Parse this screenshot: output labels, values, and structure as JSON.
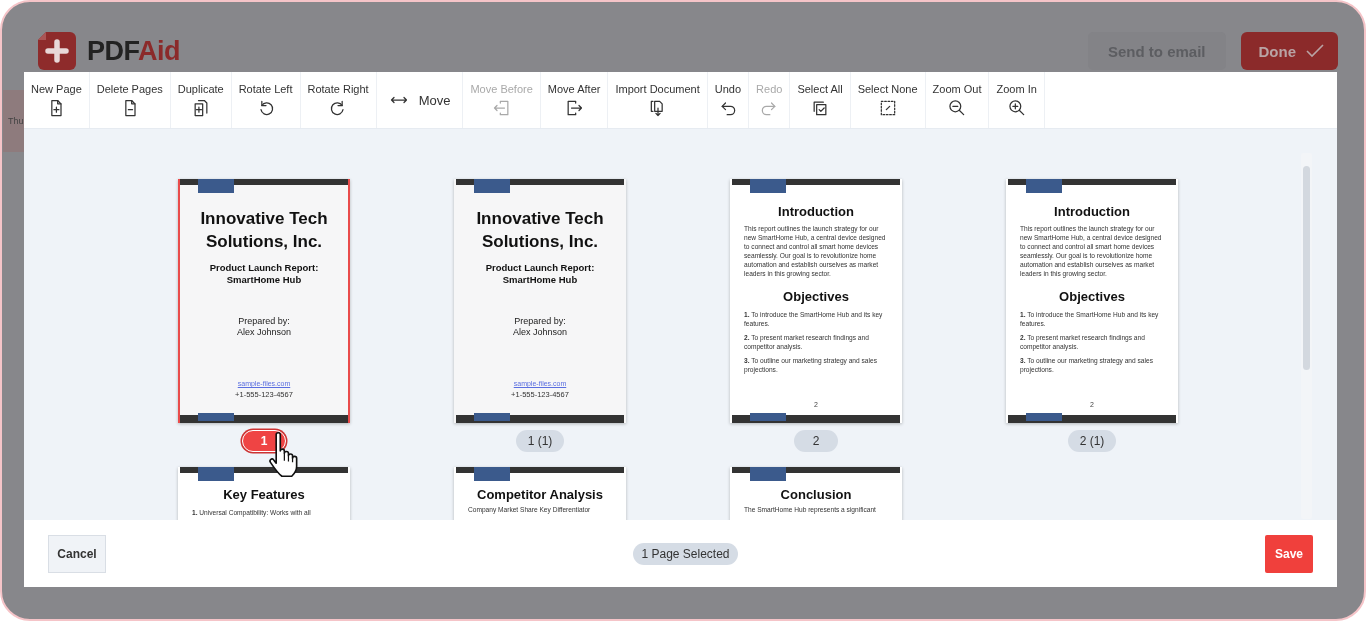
{
  "header": {
    "logo_part_1": "PDF",
    "logo_part_2": "Aid",
    "background_tab": "Thu",
    "send_button": "Send to email",
    "done_button": "Done"
  },
  "toolbar": [
    {
      "label": "New Page",
      "kind": "stacked",
      "disabled": false
    },
    {
      "label": "Delete Pages",
      "kind": "stacked",
      "disabled": false
    },
    {
      "label": "Duplicate",
      "kind": "stacked",
      "disabled": false
    },
    {
      "label": "Rotate Left",
      "kind": "stacked",
      "disabled": false
    },
    {
      "label": "Rotate Right",
      "kind": "stacked",
      "disabled": false
    },
    {
      "label": "Move",
      "kind": "inline",
      "disabled": false
    },
    {
      "label": "Move Before",
      "kind": "stacked",
      "disabled": true
    },
    {
      "label": "Move After",
      "kind": "stacked",
      "disabled": false
    },
    {
      "label": "Import Document",
      "kind": "stacked",
      "disabled": false
    },
    {
      "label": "Undo",
      "kind": "stacked",
      "disabled": false
    },
    {
      "label": "Redo",
      "kind": "stacked",
      "disabled": true
    },
    {
      "label": "Select All",
      "kind": "stacked",
      "disabled": false
    },
    {
      "label": "Select None",
      "kind": "stacked",
      "disabled": false
    },
    {
      "label": "Zoom Out",
      "kind": "stacked",
      "disabled": false
    },
    {
      "label": "Zoom In",
      "kind": "stacked",
      "disabled": false
    }
  ],
  "pages": [
    {
      "kind": "cover",
      "selected": true,
      "label": "1",
      "title": "Innovative Tech Solutions, Inc.",
      "subtitle": "Product Launch Report: SmartHome Hub",
      "prepared_by": "Prepared by:",
      "author": "Alex Johnson",
      "link": "sample-files.com",
      "phone": "+1-555-123-4567"
    },
    {
      "kind": "cover",
      "selected": false,
      "label": "1 (1)",
      "title": "Innovative Tech Solutions, Inc.",
      "subtitle": "Product Launch Report: SmartHome Hub",
      "prepared_by": "Prepared by:",
      "author": "Alex Johnson",
      "link": "sample-files.com",
      "phone": "+1-555-123-4567"
    },
    {
      "kind": "text",
      "selected": false,
      "label": "2",
      "page_number": "2",
      "sections": [
        {
          "heading": "Introduction",
          "paragraph": "This report outlines the launch strategy for our new SmartHome Hub, a central device designed to connect and control all smart home devices seamlessly. Our goal is to revolutionize home automation and establish ourselves as market leaders in this growing sector."
        },
        {
          "heading": "Objectives",
          "items": [
            "**1.** To introduce the SmartHome Hub and its key features.",
            "**2.** To present market research findings and competitor analysis.",
            "**3.** To outline our marketing strategy and sales projections."
          ]
        }
      ]
    },
    {
      "kind": "text",
      "selected": false,
      "label": "2 (1)",
      "page_number": "2",
      "sections": [
        {
          "heading": "Introduction",
          "paragraph": "This report outlines the launch strategy for our new SmartHome Hub, a central device designed to connect and control all smart home devices seamlessly. Our goal is to revolutionize home automation and establish ourselves as market leaders in this growing sector."
        },
        {
          "heading": "Objectives",
          "items": [
            "**1.** To introduce the SmartHome Hub and its key features.",
            "**2.** To present market research findings and competitor analysis.",
            "**3.** To outline our marketing strategy and sales projections."
          ]
        }
      ]
    },
    {
      "kind": "text",
      "selected": false,
      "sections": [
        {
          "heading": "Key Features",
          "items": [
            "**1.** Universal Compatibility: Works with all"
          ]
        }
      ]
    },
    {
      "kind": "text",
      "selected": false,
      "sections": [
        {
          "heading": "Competitor Analysis",
          "paragraph": "Company Market Share Key Differentiator"
        }
      ]
    },
    {
      "kind": "text",
      "selected": false,
      "sections": [
        {
          "heading": "Conclusion",
          "paragraph": "The SmartHome Hub represents a significant"
        }
      ]
    }
  ],
  "footer": {
    "cancel_button": "Cancel",
    "status": "1 Page Selected",
    "save_button": "Save"
  }
}
